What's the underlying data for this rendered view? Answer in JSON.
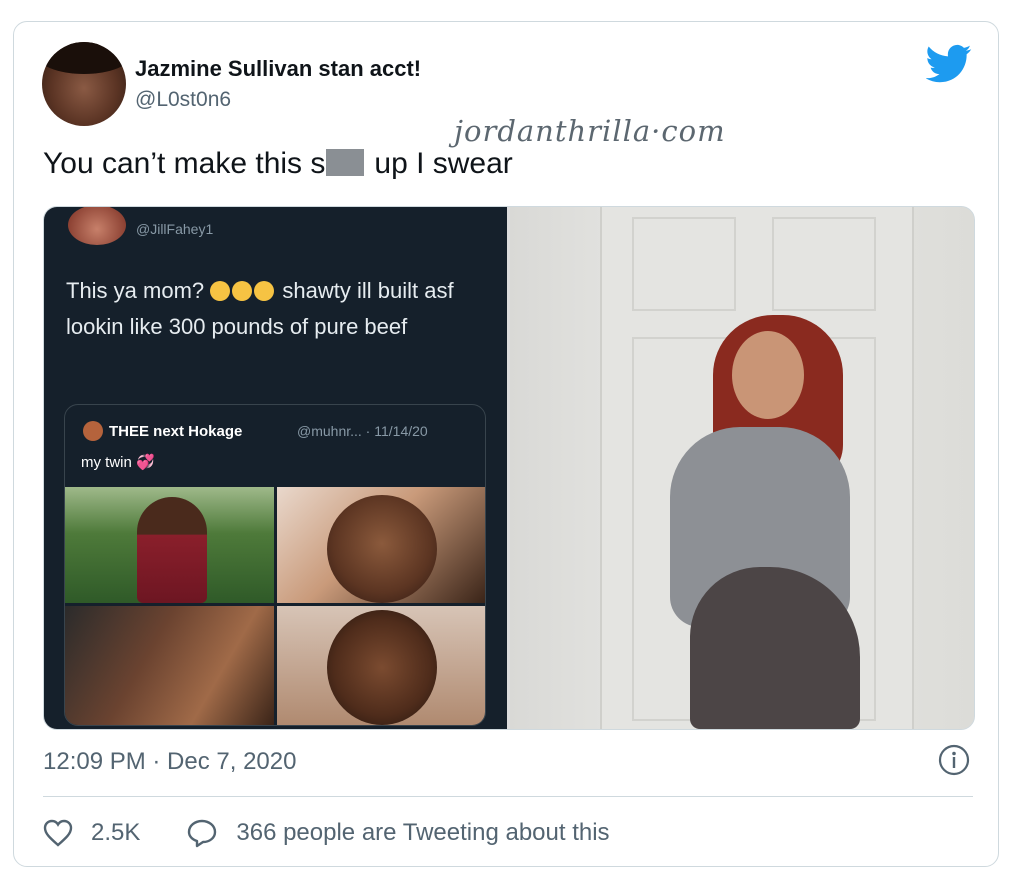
{
  "tweet": {
    "author_name": "Jazmine Sullivan stan acct!",
    "author_handle": "@L0st0n6",
    "text_before_censor": "You can’t make this s",
    "text_after_censor": "up I swear",
    "timestamp": "12:09 PM · Dec 7, 2020",
    "likes": "2.5K",
    "conversation_label": "366 people are Tweeting about this",
    "brand_color": "#1d9bf0"
  },
  "watermark": "jordanthrilla·com",
  "embedded": {
    "handle": "@JillFahey1",
    "text": "This ya mom? 😭😭😭 shawty ill built asf lookin like 300 pounds of pure beef",
    "text_part1": "This ya mom?",
    "text_part2": "shawty ill built asf lookin like 300 pounds of pure beef",
    "quote": {
      "name": "THEE next Hokage",
      "meta": "@muhnr... · 11/14/20",
      "text": "my twin"
    }
  }
}
